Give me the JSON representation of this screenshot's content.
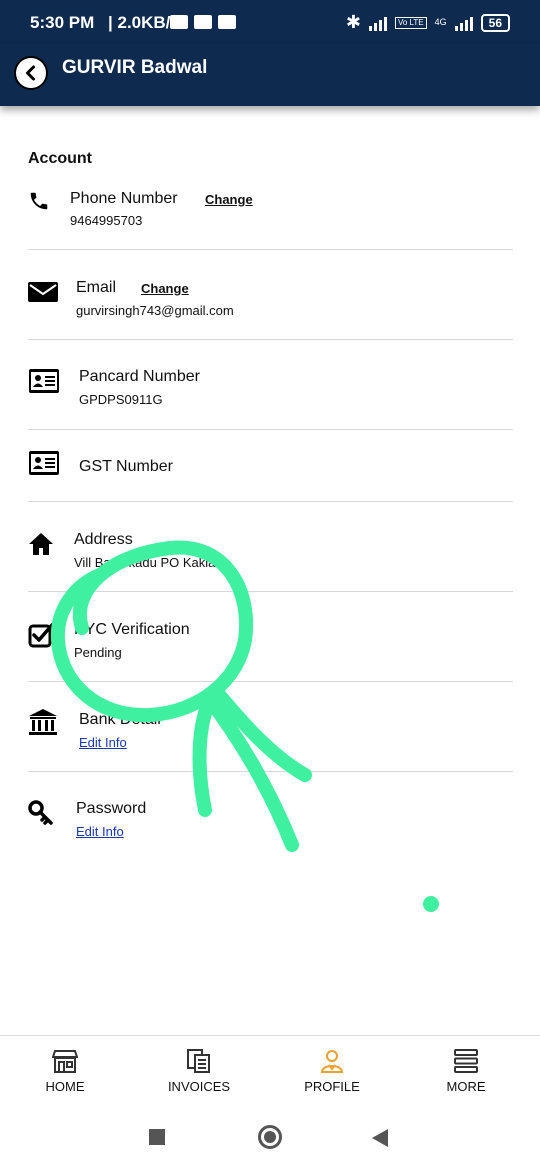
{
  "status_bar": {
    "time": "5:30 PM",
    "speed": "2.0KB/s",
    "volte": "Vo LTE",
    "network": "4G",
    "battery": "56"
  },
  "app_bar": {
    "title": "GURVIR Badwal"
  },
  "account": {
    "section_title": "Account",
    "phone": {
      "label": "Phone Number",
      "value": "9464995703",
      "action": "Change"
    },
    "email": {
      "label": "Email",
      "value": "gurvirsingh743@gmail.com",
      "action": "Change"
    },
    "pancard": {
      "label": "Pancard Number",
      "value": "GPDPS0911G"
    },
    "gst": {
      "label": "GST Number"
    },
    "address": {
      "label": "Address",
      "value": "Vill Basarkadu PO Kakiana"
    },
    "kyc": {
      "label": "KYC Verification",
      "value": "Pending"
    },
    "bank": {
      "label": "Bank Detail",
      "action": "Edit Info"
    },
    "password": {
      "label": "Password",
      "action": "Edit Info"
    }
  },
  "bottom_nav": {
    "items": [
      {
        "label": "HOME",
        "icon": "store-icon"
      },
      {
        "label": "INVOICES",
        "icon": "documents-icon"
      },
      {
        "label": "PROFILE",
        "icon": "profile-icon",
        "active": true
      },
      {
        "label": "MORE",
        "icon": "menu-icon"
      }
    ]
  },
  "colors": {
    "header_bg": "#0f2a4f",
    "link": "#1a36b8",
    "active_nav": "#f0a030",
    "annotation": "#3ef0a0"
  }
}
